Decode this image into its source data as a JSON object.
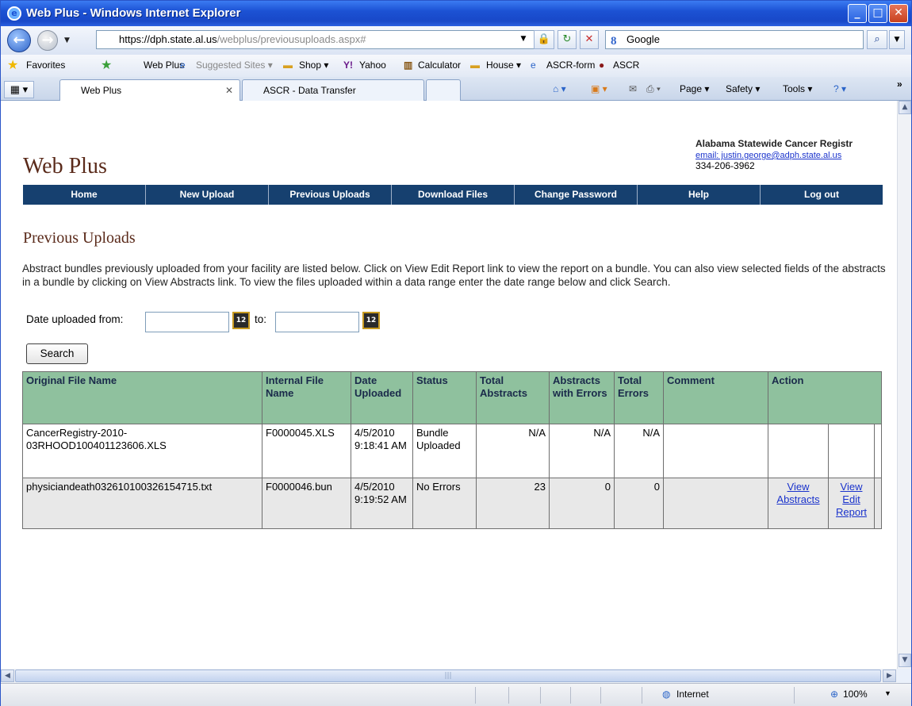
{
  "window": {
    "title": "Web Plus - Windows Internet Explorer"
  },
  "address": {
    "url_host": "https://dph.state.al.us",
    "url_path": "/webplus/previousuploads.aspx#",
    "search_engine": "Google"
  },
  "favorites": {
    "label": "Favorites",
    "items": [
      "Web Plus",
      "Suggested Sites ▾",
      "Shop ▾",
      "Yahoo",
      "Calculator",
      "House ▾",
      "ASCR-form",
      "ASCR"
    ]
  },
  "tabs": [
    {
      "label": "Web Plus"
    },
    {
      "label": "ASCR - Data Transfer"
    }
  ],
  "commands": {
    "page": "Page ▾",
    "safety": "Safety ▾",
    "tools": "Tools ▾"
  },
  "site": {
    "logo": "Web Plus",
    "org_name": "Alabama Statewide Cancer Registr",
    "email": "email: justin.george@adph.state.al.us",
    "phone": "334-206-3962"
  },
  "menu": [
    "Home",
    "New Upload",
    "Previous Uploads",
    "Download Files",
    "Change Password",
    "Help",
    "Log out"
  ],
  "page": {
    "title": "Previous Uploads",
    "intro": "Abstract bundles previously uploaded from your facility are listed below. Click on View Edit Report link to view the report on a bundle. You can also view selected fields of the abstracts in a bundle by clicking on View Abstracts link. To view the files uploaded within a data range enter the date range below and click Search.",
    "date_from_label": "Date uploaded from:",
    "date_to_label": "to:",
    "search_label": "Search"
  },
  "table": {
    "headers": [
      "Original File Name",
      "Internal File Name",
      "Date Uploaded",
      "Status",
      "Total Abstracts",
      "Abstracts with Errors",
      "Total Errors",
      "Comment",
      "Action"
    ],
    "rows": [
      {
        "original": "CancerRegistry-2010-03RHOOD100401123606.XLS",
        "internal": "F0000045.XLS",
        "date": "4/5/2010 9:18:41 AM",
        "status": "Bundle Uploaded",
        "total": "N/A",
        "with_errors": "N/A",
        "errors": "N/A",
        "comment": "",
        "action1": "",
        "action2": ""
      },
      {
        "original": "physiciandeath032610100326154715.txt",
        "internal": "F0000046.bun",
        "date": "4/5/2010 9:19:52 AM",
        "status": "No Errors",
        "total": "23",
        "with_errors": "0",
        "errors": "0",
        "comment": "",
        "action1": "View Abstracts",
        "action2": "View Edit Report"
      }
    ]
  },
  "statusbar": {
    "zone": "Internet",
    "zoom": "100%"
  }
}
